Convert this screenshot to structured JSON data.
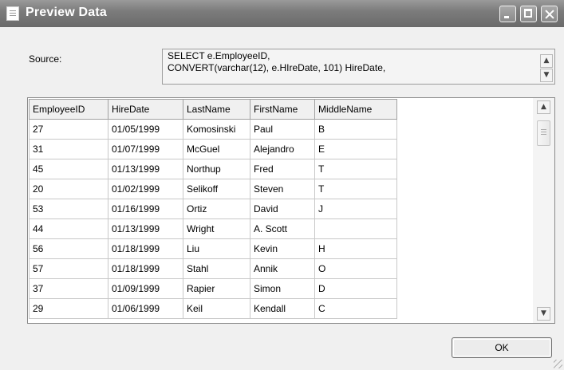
{
  "window": {
    "title": "Preview Data",
    "icon": "document-icon",
    "title_buttons": [
      "minimize",
      "maximize",
      "close"
    ],
    "titlebar_color": "#7c7c7c"
  },
  "source": {
    "label": "Source:",
    "line1": "SELECT e.EmployeeID,",
    "line2": "CONVERT(varchar(12), e.HIreDate, 101) HireDate,"
  },
  "table": {
    "columns": [
      "EmployeeID",
      "HireDate",
      "LastName",
      "FirstName",
      "MiddleName"
    ],
    "rows": [
      [
        "27",
        "01/05/1999",
        "Komosinski",
        "Paul",
        "B"
      ],
      [
        "31",
        "01/07/1999",
        "McGuel",
        "Alejandro",
        "E"
      ],
      [
        "45",
        "01/13/1999",
        "Northup",
        "Fred",
        "T"
      ],
      [
        "20",
        "01/02/1999",
        "Selikoff",
        "Steven",
        "T"
      ],
      [
        "53",
        "01/16/1999",
        "Ortiz",
        "David",
        "J"
      ],
      [
        "44",
        "01/13/1999",
        "Wright",
        "A. Scott",
        ""
      ],
      [
        "56",
        "01/18/1999",
        "Liu",
        "Kevin",
        "H"
      ],
      [
        "57",
        "01/18/1999",
        "Stahl",
        "Annik",
        "O"
      ],
      [
        "37",
        "01/09/1999",
        "Rapier",
        "Simon",
        "D"
      ],
      [
        "29",
        "01/06/1999",
        "Keil",
        "Kendall",
        "C"
      ]
    ]
  },
  "buttons": {
    "ok": "OK"
  }
}
